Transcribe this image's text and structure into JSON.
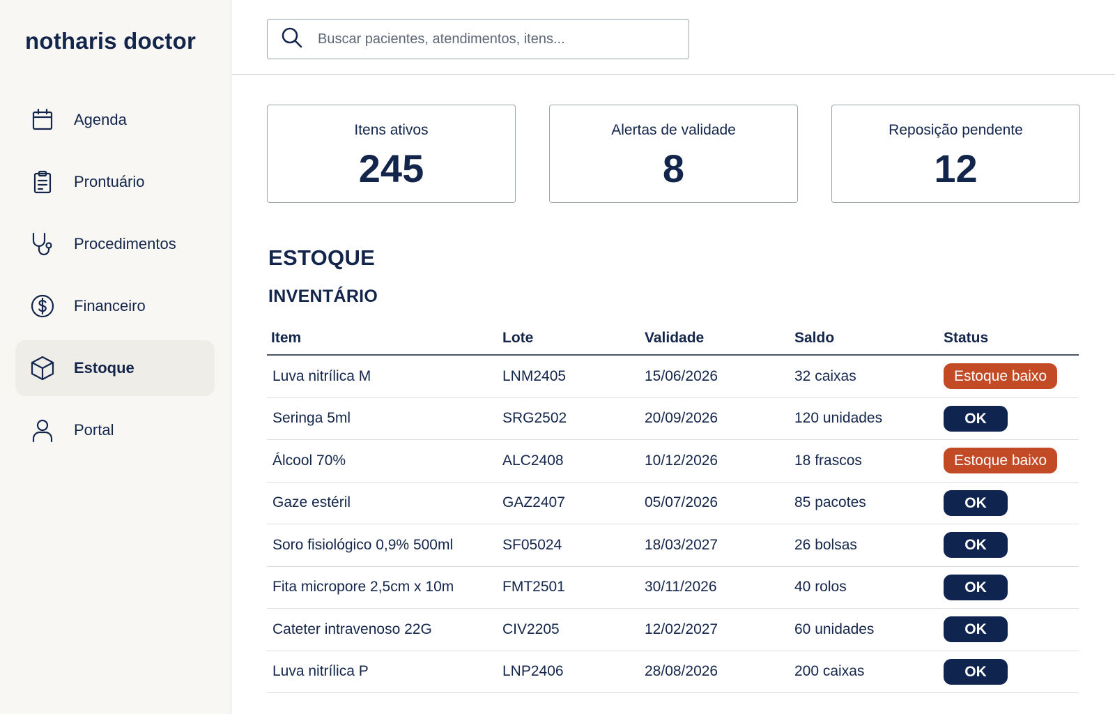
{
  "app": {
    "brand": "notharis doctor"
  },
  "sidebar": {
    "items": [
      {
        "key": "agenda",
        "label": "Agenda",
        "icon": "calendar-icon",
        "active": false
      },
      {
        "key": "prontuario",
        "label": "Prontuário",
        "icon": "clipboard-icon",
        "active": false
      },
      {
        "key": "procedimentos",
        "label": "Procedimentos",
        "icon": "stethoscope-icon",
        "active": false
      },
      {
        "key": "financeiro",
        "label": "Financeiro",
        "icon": "dollar-circle-icon",
        "active": false
      },
      {
        "key": "estoque",
        "label": "Estoque",
        "icon": "box-icon",
        "active": true
      },
      {
        "key": "portal",
        "label": "Portal",
        "icon": "user-icon",
        "active": false
      }
    ]
  },
  "search": {
    "placeholder": "Buscar pacientes, atendimentos, itens...",
    "value": ""
  },
  "cards": [
    {
      "label": "Itens ativos",
      "value": "245"
    },
    {
      "label": "Alertas de validade",
      "value": "8"
    },
    {
      "label": "Reposição pendente",
      "value": "12"
    }
  ],
  "section": {
    "title": "ESTOQUE",
    "subtitle": "INVENTÁRIO"
  },
  "table": {
    "columns": [
      "Item",
      "Lote",
      "Validade",
      "Saldo",
      "Status"
    ],
    "rows": [
      {
        "item": "Luva nitrílica M",
        "lote": "LNM2405",
        "validade": "15/06/2026",
        "saldo": "32 caixas",
        "status": "Estoque baixo",
        "status_type": "low"
      },
      {
        "item": "Seringa 5ml",
        "lote": "SRG2502",
        "validade": "20/09/2026",
        "saldo": "120 unidades",
        "status": "OK",
        "status_type": "ok"
      },
      {
        "item": "Álcool 70%",
        "lote": "ALC2408",
        "validade": "10/12/2026",
        "saldo": "18 frascos",
        "status": "Estoque baixo",
        "status_type": "low"
      },
      {
        "item": "Gaze estéril",
        "lote": "GAZ2407",
        "validade": "05/07/2026",
        "saldo": "85 pacotes",
        "status": "OK",
        "status_type": "ok"
      },
      {
        "item": "Soro fisiológico 0,9% 500ml",
        "lote": "SF05024",
        "validade": "18/03/2027",
        "saldo": "26 bolsas",
        "status": "OK",
        "status_type": "ok"
      },
      {
        "item": "Fita micropore 2,5cm x 10m",
        "lote": "FMT2501",
        "validade": "30/11/2026",
        "saldo": "40 rolos",
        "status": "OK",
        "status_type": "ok"
      },
      {
        "item": "Cateter intravenoso 22G",
        "lote": "CIV2205",
        "validade": "12/02/2027",
        "saldo": "60 unidades",
        "status": "OK",
        "status_type": "ok"
      },
      {
        "item": "Luva nitrílica P",
        "lote": "LNP2406",
        "validade": "28/08/2026",
        "saldo": "200 caixas",
        "status": "OK",
        "status_type": "ok"
      }
    ]
  },
  "colors": {
    "navy": "#13254a",
    "ok_badge": "#0f2550",
    "low_badge": "#c24a25",
    "sidebar_bg": "#f8f7f4"
  }
}
